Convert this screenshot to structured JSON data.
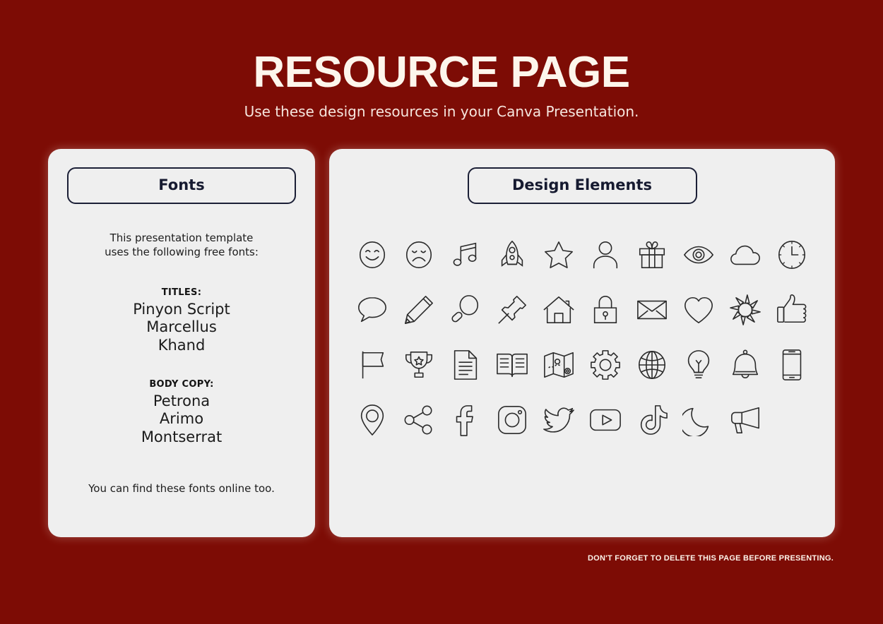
{
  "header": {
    "title": "RESOURCE PAGE",
    "subtitle": "Use these design resources in your Canva Presentation."
  },
  "colors": {
    "background": "#7d0c05",
    "panel": "#efefef",
    "badge_border": "#1b1f36",
    "badge_text": "#161a30",
    "title_text": "#fdf6ec",
    "icon_stroke": "#2b2b2b"
  },
  "fonts_panel": {
    "badge_label": "Fonts",
    "intro_line_1": "This presentation template",
    "intro_line_2": "uses the following free fonts:",
    "groups": [
      {
        "label": "TITLES:",
        "fonts": [
          "Pinyon Script",
          "Marcellus",
          "Khand"
        ]
      },
      {
        "label": "BODY COPY:",
        "fonts": [
          "Petrona",
          "Arimo",
          "Montserrat"
        ]
      }
    ],
    "footnote": "You can find these fonts online too."
  },
  "design_elements_panel": {
    "badge_label": "Design Elements",
    "columns": 10,
    "rows": 4,
    "icons": [
      "smiley-face-icon",
      "sad-face-icon",
      "music-note-icon",
      "rocket-icon",
      "star-icon",
      "person-icon",
      "gift-icon",
      "eye-icon",
      "cloud-icon",
      "clock-icon",
      "speech-bubble-icon",
      "pencil-icon",
      "magnifying-glass-icon",
      "pushpin-icon",
      "house-icon",
      "lock-icon",
      "envelope-icon",
      "heart-icon",
      "sun-icon",
      "thumbs-up-icon",
      "flag-icon",
      "trophy-icon",
      "document-icon",
      "open-book-icon",
      "map-icon",
      "gear-icon",
      "globe-icon",
      "lightbulb-icon",
      "bell-icon",
      "smartphone-icon",
      "location-pin-icon",
      "share-icon",
      "facebook-icon",
      "instagram-icon",
      "twitter-icon",
      "youtube-icon",
      "tiktok-icon",
      "moon-icon",
      "megaphone-icon"
    ]
  },
  "footer": {
    "note": "DON'T FORGET TO DELETE THIS PAGE BEFORE PRESENTING."
  }
}
